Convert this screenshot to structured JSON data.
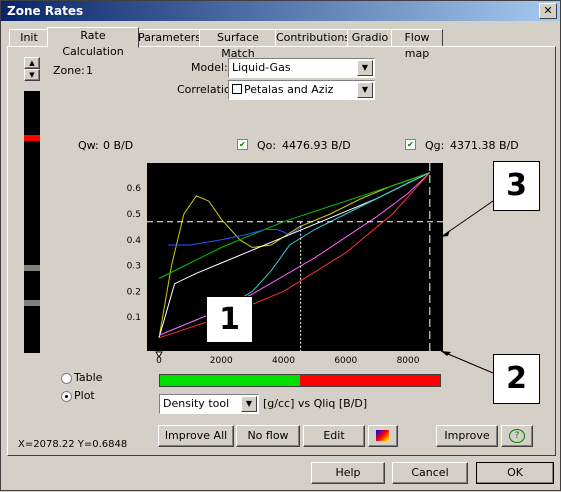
{
  "window": {
    "title": "Zone Rates",
    "close_glyph": "✕"
  },
  "tabs": [
    "Init",
    "Rate Calculation",
    "Parameters",
    "Surface Match",
    "Contributions",
    "Gradio",
    "Flow map"
  ],
  "zone": {
    "label": "Zone:",
    "value": "1"
  },
  "model": {
    "label": "Model:",
    "value": "Liquid-Gas"
  },
  "correlation": {
    "label": "Correlation",
    "value": "Petalas and Aziz"
  },
  "rates": {
    "qw": {
      "label": "Qw:",
      "value": "0 B/D"
    },
    "qo": {
      "label": "Qo:",
      "value": "4476.93 B/D",
      "checked": true
    },
    "qg": {
      "label": "Qg:",
      "value": "4371.38 B/D",
      "checked": true
    }
  },
  "callouts": {
    "c1": "1",
    "c2": "2",
    "c3": "3"
  },
  "view": {
    "table": "Table",
    "plot": "Plot",
    "selected": "plot"
  },
  "tool_select": {
    "value": "Density tool",
    "units": "[g/cc] vs Qliq [B/D]"
  },
  "buttons": {
    "improve_all": "Improve All",
    "no_flow": "No flow",
    "edit": "Edit",
    "improve": "Improve"
  },
  "coords": "X=2078.22 Y=0.6848",
  "footer": {
    "help": "Help",
    "cancel": "Cancel",
    "ok": "OK"
  },
  "chart_data": {
    "type": "line",
    "xlim": [
      0,
      9000
    ],
    "ylim": [
      0,
      0.7
    ],
    "x_ticks": [
      "0",
      "2000",
      "4000",
      "6000",
      "8000"
    ],
    "y_ticks": [
      "0.1",
      "0.2",
      "0.3",
      "0.4",
      "0.5",
      "0.6"
    ],
    "crosshair": {
      "x": 4550,
      "y": 0.47
    },
    "endpoint": {
      "x": 8700,
      "y": 0.66
    },
    "progress_green_fraction": 0.5,
    "colors": {
      "bg": "#000000",
      "green": "#00e000",
      "red": "#ff0000"
    },
    "series": [
      {
        "color": "#d0d000",
        "points": [
          [
            0,
            0.02
          ],
          [
            400,
            0.3
          ],
          [
            800,
            0.5
          ],
          [
            1200,
            0.57
          ],
          [
            1600,
            0.55
          ],
          [
            2000,
            0.48
          ],
          [
            2600,
            0.4
          ],
          [
            3000,
            0.37
          ],
          [
            3600,
            0.38
          ],
          [
            4500,
            0.45
          ],
          [
            5500,
            0.5
          ],
          [
            6500,
            0.56
          ],
          [
            7500,
            0.61
          ],
          [
            8700,
            0.66
          ]
        ]
      },
      {
        "color": "#00c000",
        "points": [
          [
            0,
            0.25
          ],
          [
            1000,
            0.31
          ],
          [
            2000,
            0.37
          ],
          [
            3000,
            0.42
          ],
          [
            4000,
            0.47
          ],
          [
            5000,
            0.51
          ],
          [
            6000,
            0.55
          ],
          [
            7000,
            0.59
          ],
          [
            8000,
            0.63
          ],
          [
            8700,
            0.66
          ]
        ]
      },
      {
        "color": "#3050ff",
        "points": [
          [
            300,
            0.38
          ],
          [
            1000,
            0.38
          ],
          [
            2000,
            0.4
          ],
          [
            2800,
            0.42
          ],
          [
            3400,
            0.44
          ],
          [
            3800,
            0.44
          ],
          [
            4200,
            0.42
          ],
          [
            4600,
            0.45
          ]
        ]
      },
      {
        "color": "#ffffff",
        "points": [
          [
            0,
            0.02
          ],
          [
            500,
            0.23
          ],
          [
            1200,
            0.27
          ],
          [
            2000,
            0.31
          ],
          [
            3000,
            0.36
          ],
          [
            4000,
            0.41
          ],
          [
            5000,
            0.46
          ],
          [
            6000,
            0.51
          ],
          [
            7000,
            0.56
          ],
          [
            8000,
            0.62
          ],
          [
            8700,
            0.66
          ]
        ]
      },
      {
        "color": "#30d0d0",
        "points": [
          [
            0,
            0.03
          ],
          [
            1000,
            0.08
          ],
          [
            2000,
            0.13
          ],
          [
            3000,
            0.2
          ],
          [
            3600,
            0.28
          ],
          [
            4200,
            0.38
          ],
          [
            5000,
            0.44
          ],
          [
            6000,
            0.5
          ],
          [
            7000,
            0.56
          ],
          [
            8000,
            0.62
          ],
          [
            8700,
            0.66
          ]
        ]
      },
      {
        "color": "#ff60ff",
        "points": [
          [
            0,
            0.03
          ],
          [
            1000,
            0.08
          ],
          [
            2000,
            0.13
          ],
          [
            3000,
            0.19
          ],
          [
            4000,
            0.26
          ],
          [
            5000,
            0.33
          ],
          [
            6000,
            0.41
          ],
          [
            7000,
            0.49
          ],
          [
            8000,
            0.58
          ],
          [
            8700,
            0.66
          ]
        ]
      },
      {
        "color": "#ff3030",
        "points": [
          [
            0,
            0.02
          ],
          [
            2000,
            0.1
          ],
          [
            4000,
            0.2
          ],
          [
            6000,
            0.35
          ],
          [
            7500,
            0.5
          ],
          [
            8700,
            0.66
          ]
        ]
      }
    ]
  }
}
